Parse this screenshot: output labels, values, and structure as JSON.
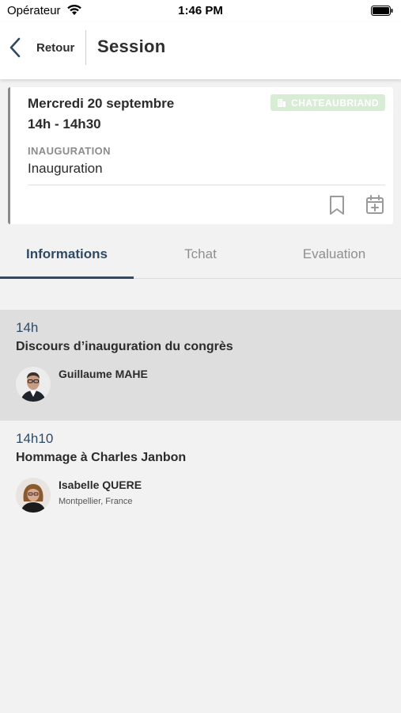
{
  "status_bar": {
    "carrier": "Opérateur",
    "time": "1:46 PM"
  },
  "header": {
    "back_label": "Retour",
    "title": "Session"
  },
  "session": {
    "date": "Mercredi 20 septembre",
    "time_range": "14h - 14h30",
    "room": "CHATEAUBRIAND",
    "category": "INAUGURATION",
    "name": "Inauguration"
  },
  "tabs": [
    {
      "label": "Informations",
      "active": true
    },
    {
      "label": "Tchat",
      "active": false
    },
    {
      "label": "Evaluation",
      "active": false
    }
  ],
  "talks": [
    {
      "time": "14h",
      "title": "Discours d’inauguration du congrès",
      "speaker": {
        "name": "Guillaume MAHE",
        "location": ""
      }
    },
    {
      "time": "14h10",
      "title": "Hommage à Charles Janbon",
      "speaker": {
        "name": "Isabelle QUERE",
        "location": "Montpellier, France"
      }
    }
  ],
  "colors": {
    "accent": "#2f4a64",
    "room_badge_bg": "#d9ecd6",
    "highlight_row": "#dedede"
  }
}
